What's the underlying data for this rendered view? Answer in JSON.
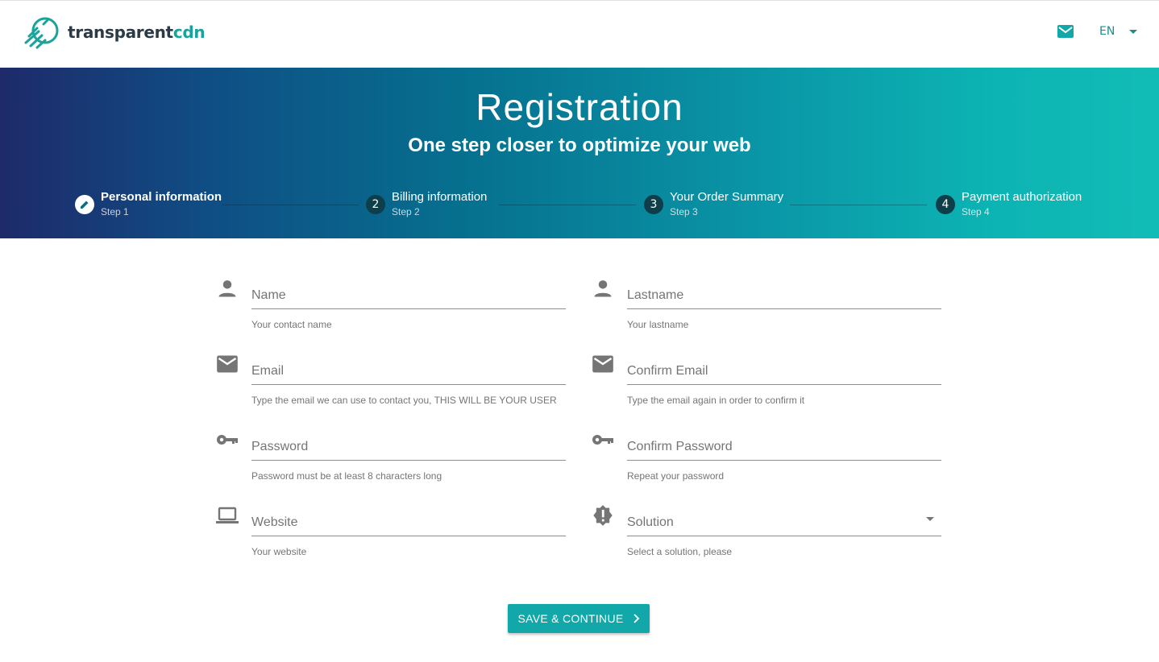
{
  "header": {
    "logo_text_bold": "transparent",
    "logo_text_accent": "cdn",
    "mail_icon": "mail-icon",
    "language": "EN"
  },
  "hero": {
    "title": "Registration",
    "subtitle": "One step closer to optimize your web"
  },
  "stepper": {
    "steps": [
      {
        "number": "",
        "label": "Personal information",
        "sub": "Step 1",
        "state": "active"
      },
      {
        "number": "2",
        "label": "Billing information",
        "sub": "Step 2",
        "state": "pending"
      },
      {
        "number": "3",
        "label": "Your Order Summary",
        "sub": "Step 3",
        "state": "pending"
      },
      {
        "number": "4",
        "label": "Payment authorization",
        "sub": "Step 4",
        "state": "pending"
      }
    ]
  },
  "form": {
    "name": {
      "placeholder": "Name",
      "hint": "Your contact name",
      "value": ""
    },
    "lastname": {
      "placeholder": "Lastname",
      "hint": "Your lastname",
      "value": ""
    },
    "email": {
      "placeholder": "Email",
      "hint": "Type the email we can use to contact you, THIS WILL BE YOUR USER",
      "value": ""
    },
    "confirm_email": {
      "placeholder": "Confirm Email",
      "hint": "Type the email again in order to confirm it",
      "value": ""
    },
    "password": {
      "placeholder": "Password",
      "hint": "Password must be at least 8 characters long",
      "value": ""
    },
    "confirm_password": {
      "placeholder": "Confirm Password",
      "hint": "Repeat your password",
      "value": ""
    },
    "website": {
      "placeholder": "Website",
      "hint": "Your website",
      "value": ""
    },
    "solution": {
      "placeholder": "Solution",
      "hint": "Select a solution, please",
      "value": ""
    }
  },
  "actions": {
    "save_label": "SAVE & CONTINUE"
  },
  "colors": {
    "accent": "#12a7a8",
    "icon_gray": "#757575"
  }
}
